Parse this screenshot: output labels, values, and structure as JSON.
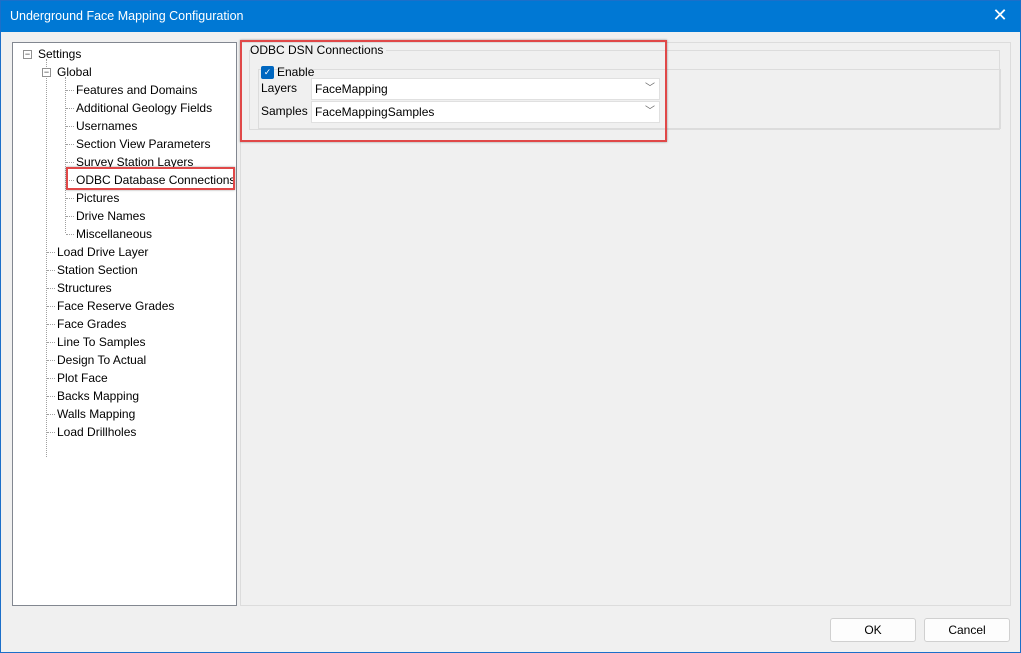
{
  "window": {
    "title": "Underground Face Mapping Configuration",
    "close_icon": "close-icon"
  },
  "tree": {
    "root": "Settings",
    "global": "Global",
    "global_children": [
      "Features and Domains",
      "Additional Geology Fields",
      "Usernames",
      "Section View Parameters",
      "Survey Station Layers",
      "ODBC Database Connections",
      "Pictures",
      "Drive Names",
      "Miscellaneous"
    ],
    "selected": "ODBC Database Connections",
    "other_items": [
      "Load Drive Layer",
      "Station Section",
      "Structures",
      "Face Reserve Grades",
      "Face Grades",
      "Line To Samples",
      "Design To Actual",
      "Plot Face",
      "Backs Mapping",
      "Walls Mapping",
      "Load Drillholes"
    ]
  },
  "panel": {
    "group_title": "ODBC DSN Connections",
    "enable_label": "Enable",
    "enable_checked": true,
    "layers_label": "Layers",
    "layers_value": "FaceMapping",
    "samples_label": "Samples",
    "samples_value": "FaceMappingSamples"
  },
  "buttons": {
    "ok": "OK",
    "cancel": "Cancel"
  },
  "colors": {
    "titlebar": "#0078d4",
    "highlight": "#e04848",
    "checkbox": "#0067c0"
  }
}
